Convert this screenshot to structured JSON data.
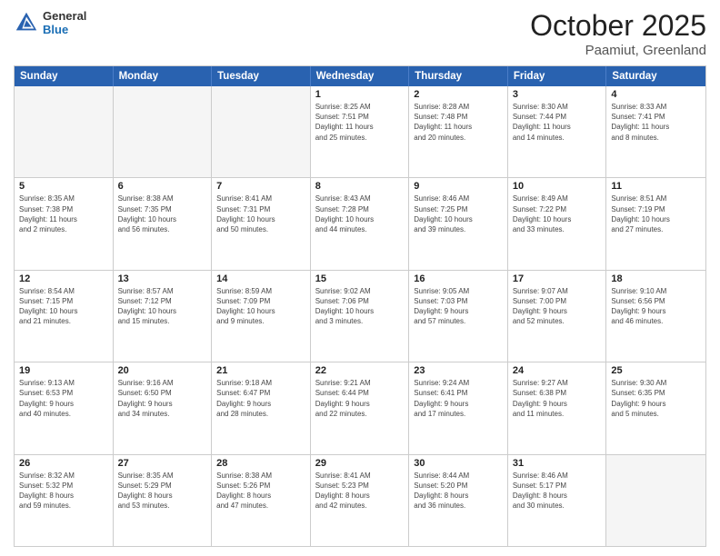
{
  "header": {
    "logo_general": "General",
    "logo_blue": "Blue",
    "title": "October 2025",
    "subtitle": "Paamiut, Greenland"
  },
  "days_of_week": [
    "Sunday",
    "Monday",
    "Tuesday",
    "Wednesday",
    "Thursday",
    "Friday",
    "Saturday"
  ],
  "weeks": [
    [
      {
        "day": "",
        "info": ""
      },
      {
        "day": "",
        "info": ""
      },
      {
        "day": "",
        "info": ""
      },
      {
        "day": "1",
        "info": "Sunrise: 8:25 AM\nSunset: 7:51 PM\nDaylight: 11 hours\nand 25 minutes."
      },
      {
        "day": "2",
        "info": "Sunrise: 8:28 AM\nSunset: 7:48 PM\nDaylight: 11 hours\nand 20 minutes."
      },
      {
        "day": "3",
        "info": "Sunrise: 8:30 AM\nSunset: 7:44 PM\nDaylight: 11 hours\nand 14 minutes."
      },
      {
        "day": "4",
        "info": "Sunrise: 8:33 AM\nSunset: 7:41 PM\nDaylight: 11 hours\nand 8 minutes."
      }
    ],
    [
      {
        "day": "5",
        "info": "Sunrise: 8:35 AM\nSunset: 7:38 PM\nDaylight: 11 hours\nand 2 minutes."
      },
      {
        "day": "6",
        "info": "Sunrise: 8:38 AM\nSunset: 7:35 PM\nDaylight: 10 hours\nand 56 minutes."
      },
      {
        "day": "7",
        "info": "Sunrise: 8:41 AM\nSunset: 7:31 PM\nDaylight: 10 hours\nand 50 minutes."
      },
      {
        "day": "8",
        "info": "Sunrise: 8:43 AM\nSunset: 7:28 PM\nDaylight: 10 hours\nand 44 minutes."
      },
      {
        "day": "9",
        "info": "Sunrise: 8:46 AM\nSunset: 7:25 PM\nDaylight: 10 hours\nand 39 minutes."
      },
      {
        "day": "10",
        "info": "Sunrise: 8:49 AM\nSunset: 7:22 PM\nDaylight: 10 hours\nand 33 minutes."
      },
      {
        "day": "11",
        "info": "Sunrise: 8:51 AM\nSunset: 7:19 PM\nDaylight: 10 hours\nand 27 minutes."
      }
    ],
    [
      {
        "day": "12",
        "info": "Sunrise: 8:54 AM\nSunset: 7:15 PM\nDaylight: 10 hours\nand 21 minutes."
      },
      {
        "day": "13",
        "info": "Sunrise: 8:57 AM\nSunset: 7:12 PM\nDaylight: 10 hours\nand 15 minutes."
      },
      {
        "day": "14",
        "info": "Sunrise: 8:59 AM\nSunset: 7:09 PM\nDaylight: 10 hours\nand 9 minutes."
      },
      {
        "day": "15",
        "info": "Sunrise: 9:02 AM\nSunset: 7:06 PM\nDaylight: 10 hours\nand 3 minutes."
      },
      {
        "day": "16",
        "info": "Sunrise: 9:05 AM\nSunset: 7:03 PM\nDaylight: 9 hours\nand 57 minutes."
      },
      {
        "day": "17",
        "info": "Sunrise: 9:07 AM\nSunset: 7:00 PM\nDaylight: 9 hours\nand 52 minutes."
      },
      {
        "day": "18",
        "info": "Sunrise: 9:10 AM\nSunset: 6:56 PM\nDaylight: 9 hours\nand 46 minutes."
      }
    ],
    [
      {
        "day": "19",
        "info": "Sunrise: 9:13 AM\nSunset: 6:53 PM\nDaylight: 9 hours\nand 40 minutes."
      },
      {
        "day": "20",
        "info": "Sunrise: 9:16 AM\nSunset: 6:50 PM\nDaylight: 9 hours\nand 34 minutes."
      },
      {
        "day": "21",
        "info": "Sunrise: 9:18 AM\nSunset: 6:47 PM\nDaylight: 9 hours\nand 28 minutes."
      },
      {
        "day": "22",
        "info": "Sunrise: 9:21 AM\nSunset: 6:44 PM\nDaylight: 9 hours\nand 22 minutes."
      },
      {
        "day": "23",
        "info": "Sunrise: 9:24 AM\nSunset: 6:41 PM\nDaylight: 9 hours\nand 17 minutes."
      },
      {
        "day": "24",
        "info": "Sunrise: 9:27 AM\nSunset: 6:38 PM\nDaylight: 9 hours\nand 11 minutes."
      },
      {
        "day": "25",
        "info": "Sunrise: 9:30 AM\nSunset: 6:35 PM\nDaylight: 9 hours\nand 5 minutes."
      }
    ],
    [
      {
        "day": "26",
        "info": "Sunrise: 8:32 AM\nSunset: 5:32 PM\nDaylight: 8 hours\nand 59 minutes."
      },
      {
        "day": "27",
        "info": "Sunrise: 8:35 AM\nSunset: 5:29 PM\nDaylight: 8 hours\nand 53 minutes."
      },
      {
        "day": "28",
        "info": "Sunrise: 8:38 AM\nSunset: 5:26 PM\nDaylight: 8 hours\nand 47 minutes."
      },
      {
        "day": "29",
        "info": "Sunrise: 8:41 AM\nSunset: 5:23 PM\nDaylight: 8 hours\nand 42 minutes."
      },
      {
        "day": "30",
        "info": "Sunrise: 8:44 AM\nSunset: 5:20 PM\nDaylight: 8 hours\nand 36 minutes."
      },
      {
        "day": "31",
        "info": "Sunrise: 8:46 AM\nSunset: 5:17 PM\nDaylight: 8 hours\nand 30 minutes."
      },
      {
        "day": "",
        "info": ""
      }
    ]
  ]
}
